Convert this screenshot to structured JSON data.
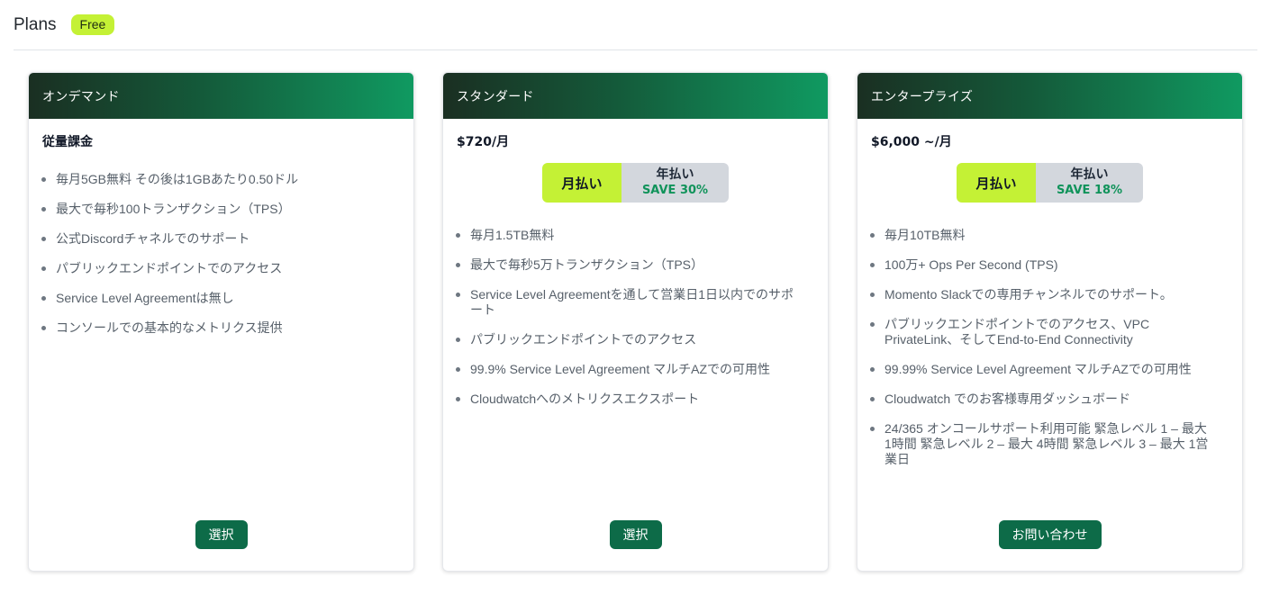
{
  "header": {
    "title": "Plans",
    "current_plan_badge": "Free"
  },
  "colors": {
    "accent_lime": "#c4f135",
    "button_green": "#0d6b48",
    "save_green": "#10935a",
    "card_header_gradient_start": "#1a2f22",
    "card_header_gradient_end": "#109a61",
    "toggle_inactive": "#d3d7dd"
  },
  "plans": [
    {
      "name": "オンデマンド",
      "price": "従量課金",
      "features": [
        "毎月5GB無料 その後は1GBあたり0.50ドル",
        "最大で毎秒100トランザクション（TPS）",
        "公式Discordチャネルでのサポート",
        "パブリックエンドポイントでのアクセス",
        "Service Level Agreementは無し",
        "コンソールでの基本的なメトリクス提供"
      ],
      "button_label": "選択"
    },
    {
      "name": "スタンダード",
      "price": "$720/月",
      "billing": {
        "monthly_label": "月払い",
        "annual_label": "年払い",
        "annual_save": "SAVE 30%",
        "selected": "monthly"
      },
      "features": [
        "毎月1.5TB無料",
        "最大で毎秒5万トランザクション（TPS）",
        "Service Level Agreementを通して営業日1日以内でのサポート",
        "パブリックエンドポイントでのアクセス",
        "99.9% Service Level Agreement マルチAZでの可用性",
        "Cloudwatchへのメトリクスエクスポート"
      ],
      "button_label": "選択"
    },
    {
      "name": "エンタープライズ",
      "price": "$6,000 ~/月",
      "billing": {
        "monthly_label": "月払い",
        "annual_label": "年払い",
        "annual_save": "SAVE 18%",
        "selected": "monthly"
      },
      "features": [
        "毎月10TB無料",
        "100万+ Ops Per Second (TPS)",
        "Momento Slackでの専用チャンネルでのサポート。",
        "パブリックエンドポイントでのアクセス、VPC PrivateLink、そしてEnd-to-End Connectivity",
        "99.99% Service Level Agreement マルチAZでの可用性",
        "Cloudwatch でのお客様専用ダッシュボード",
        "24/365 オンコールサポート利用可能 緊急レベル 1 – 最大 1時間 緊急レベル 2 – 最大 4時間 緊急レベル 3 – 最大 1営業日"
      ],
      "button_label": "お問い合わせ"
    }
  ]
}
